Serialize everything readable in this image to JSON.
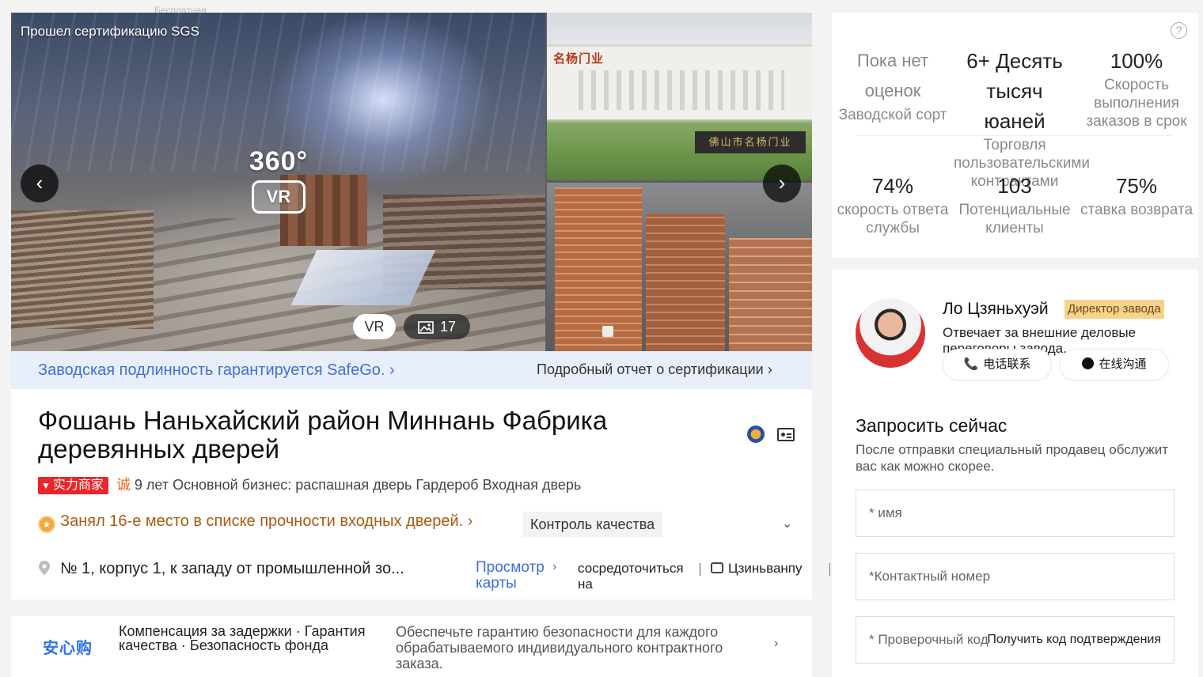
{
  "ghost_top_text": "Бесплатная",
  "gallery": {
    "sgs_label": "Прошел сертификацию SGS",
    "vr_badge_360": "360°",
    "vr_badge_vr": "VR",
    "photo_top_sign": "名杨门业",
    "photo_gate_sign": "佛山市名杨门业",
    "prev_icon": "chevron-left-icon",
    "next_icon": "chevron-right-icon",
    "vr_pill": "VR",
    "photo_count": "17"
  },
  "cert": {
    "left_link": "Заводская подлинность гарантируется SafeGo. ›",
    "right_link": "Подробный отчет о сертификации ›"
  },
  "company": {
    "title": "Фошань Наньхайский район Миннань Фабрика деревянных дверей",
    "strength_tag": "实力商家",
    "cheng": "诚",
    "years": "9 лет",
    "main_business": "Основной бизнес: распашная дверь Гардероб Входная дверь",
    "rank": "Занял 16-е место в списке прочности входных дверей. ›",
    "quality_tag": "Контроль качества",
    "address": "№ 1, корпус 1, к западу от промышленной зо...",
    "map_link": "Просмотр карты",
    "focus": "сосредоточиться на",
    "jz": "Цзиньванпу"
  },
  "guarantee": {
    "logo": "安心购",
    "text": "Компенсация за задержки · Гарантия качества · Безопасность фонда",
    "desc": "Обеспечьте гарантию безопасности для каждого обрабатываемого индивидуального контрактного заказа."
  },
  "stats": [
    {
      "value": "Пока нет оценок",
      "label": "Заводской сорт",
      "muted": true
    },
    {
      "value": "6+ Десять тысяч юаней",
      "label": "Торговля пользовательскими контрактами"
    },
    {
      "value": "100%",
      "label": "Скорость выполнения заказов в срок"
    },
    {
      "value": "74%",
      "label": "скорость ответа службы"
    },
    {
      "value": "103",
      "label": "Потенциальные клиенты"
    },
    {
      "value": "75%",
      "label": "ставка возврата"
    }
  ],
  "contact": {
    "rep_name": "Ло Цзяньхуэй",
    "rep_title": "Директор завода",
    "rep_desc": "Отвечает за внешние деловые переговоры завода.",
    "phone_btn": "电话联系",
    "chat_btn": "在线沟通",
    "inquiry_title": "Запросить сейчас",
    "inquiry_sub": "После отправки специальный продавец обслужит вас как можно скорее.",
    "name_placeholder": "* имя",
    "phone_placeholder": "*Контактный номер",
    "code_placeholder": "* Проверочный код",
    "get_code": "Получить код подтверждения"
  },
  "colors": {
    "link_blue": "#3f6fd8",
    "strength_red": "#e8262b",
    "rank_orange": "#a85b12",
    "title_badge": "#f6d28c"
  }
}
